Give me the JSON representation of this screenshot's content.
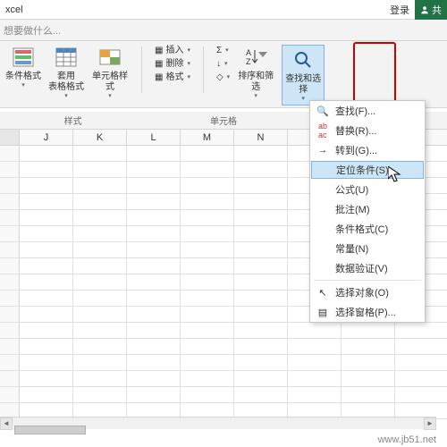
{
  "titlebar": {
    "appname": "xcel",
    "login": "登录",
    "share": "共"
  },
  "tellme": "想要做什么...",
  "ribbon": {
    "cond_format": "条件格式",
    "table_format": "套用\n表格格式",
    "cell_style": "单元格样式",
    "insert": "插入",
    "delete": "删除",
    "format": "格式",
    "sort_filter": "排序和筛选",
    "find_select": "查找和选择",
    "group_styles": "样式",
    "group_cells": "单元格"
  },
  "columns": [
    "J",
    "K",
    "L",
    "M",
    "N"
  ],
  "dropdown": {
    "find": "查找(F)...",
    "replace": "替换(R)...",
    "goto": "转到(G)...",
    "goto_special": "定位条件(S)...",
    "formulas": "公式(U)",
    "comments": "批注(M)",
    "cond_fmt": "条件格式(C)",
    "constants": "常量(N)",
    "data_valid": "数据验证(V)",
    "select_obj": "选择对象(O)",
    "select_pane": "选择窗格(P)..."
  },
  "watermark": "www.jb51.net"
}
